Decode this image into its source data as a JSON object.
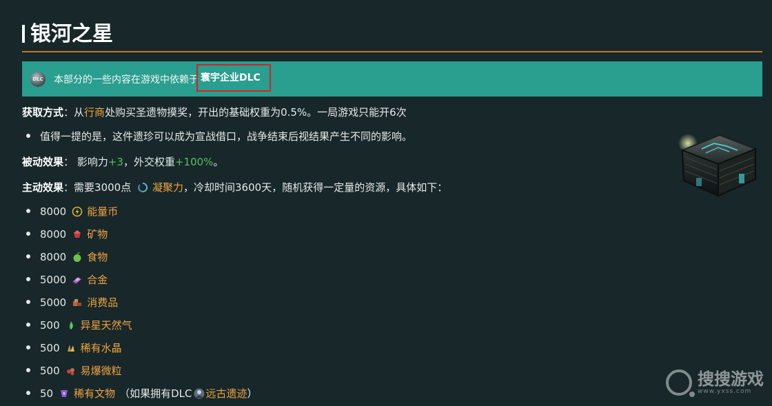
{
  "page": {
    "title": "银河之星"
  },
  "notice": {
    "logo_text": "DLC",
    "text": "本部分的一些内容在游戏中依赖于",
    "dlc_link": "寰宇企业DLC"
  },
  "acquire": {
    "label": "获取方式",
    "sep": "：",
    "text_before": "从",
    "merchant_link": "行商",
    "text_after": "处购买圣遗物摸奖，开出的基础权重为0.5%。一局游戏只能开6次"
  },
  "note": "值得一提的是，这件遗珍可以成为宣战借口，战争结束后视结果产生不同的影响。",
  "passive": {
    "label": "被动效果",
    "sep": "：",
    "text1": "影响力",
    "value1": "+3",
    "text2": "，外交权重",
    "value2": "+100%",
    "text3": "。"
  },
  "active": {
    "label": "主动效果",
    "sep": "：",
    "text_before": "需要3000点",
    "resource_link": "凝聚力",
    "text_after": "，冷却时间3600天，随机获得一定量的资源，具体如下："
  },
  "resources": [
    {
      "amount": "8000",
      "name": "能量币",
      "icon": "energy-icon",
      "color": "#d8b23a"
    },
    {
      "amount": "8000",
      "name": "矿物",
      "icon": "minerals-icon",
      "color": "#c23a3a"
    },
    {
      "amount": "8000",
      "name": "食物",
      "icon": "food-icon",
      "color": "#6cc24a"
    },
    {
      "amount": "5000",
      "name": "合金",
      "icon": "alloys-icon",
      "color": "#b565c9"
    },
    {
      "amount": "5000",
      "name": "消费品",
      "icon": "consumer-goods-icon",
      "color": "#b8673a"
    },
    {
      "amount": "500",
      "name": "异星天然气",
      "icon": "exotic-gases-icon",
      "color": "#3fae4a"
    },
    {
      "amount": "500",
      "name": "稀有水晶",
      "icon": "rare-crystals-icon",
      "color": "#c79536"
    },
    {
      "amount": "500",
      "name": "易爆微粒",
      "icon": "volatile-motes-icon",
      "color": "#b24a3a"
    },
    {
      "amount": "50",
      "name": "稀有文物",
      "icon": "minor-artifacts-icon",
      "color": "#8d5ad6"
    }
  ],
  "last_note": {
    "text_before": "（如果拥有DLC",
    "link": "远古遗迹",
    "text_after": "）"
  },
  "watermark": {
    "name": "搜搜游戏",
    "url": "www.yxss.com"
  }
}
